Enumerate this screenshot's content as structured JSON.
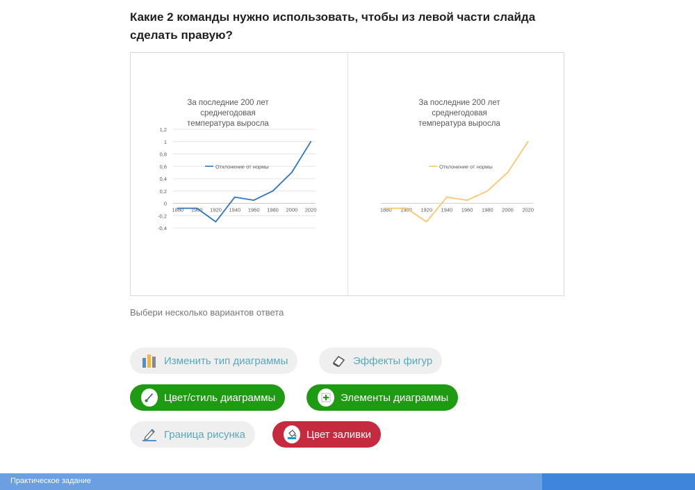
{
  "question": "Какие 2 команды нужно использовать, чтобы из левой части слайда сделать правую?",
  "hint": "Выбери несколько вариантов ответа",
  "options": [
    {
      "label": "Изменить тип диаграммы",
      "icon": "bar-chart-icon",
      "state": "unselected"
    },
    {
      "label": "Эффекты фигур",
      "icon": "eraser-icon",
      "state": "unselected"
    },
    {
      "label": "Цвет/стиль диаграммы",
      "icon": "brush-icon",
      "state": "correct"
    },
    {
      "label": "Элементы диаграммы",
      "icon": "plus-icon",
      "state": "correct"
    },
    {
      "label": "Граница рисунка",
      "icon": "pencil-icon",
      "state": "unselected"
    },
    {
      "label": "Цвет заливки",
      "icon": "paint-bucket-icon",
      "state": "wrong"
    }
  ],
  "footer": {
    "label": "Практическое задание",
    "progress": 0.78
  },
  "colors": {
    "left_line": "#2e75c0",
    "right_line": "#ffc56a",
    "correct": "#1e9b12",
    "wrong": "#c62a3f",
    "neutral_text": "#55aabb"
  },
  "chart_data": [
    {
      "type": "line",
      "title": "За последние 200 лет среднегодовая температура выросла",
      "x": [
        "1880",
        "1900",
        "1920",
        "1940",
        "1960",
        "1980",
        "2000",
        "2020"
      ],
      "series": [
        {
          "name": "Отклонение от нормы",
          "values": [
            -0.08,
            -0.08,
            -0.3,
            0.1,
            0.05,
            0.2,
            0.5,
            1.0
          ]
        }
      ],
      "yticks": [
        "1,2",
        "1",
        "0,8",
        "0,6",
        "0,4",
        "0,2",
        "0",
        "-0,2",
        "-0,4"
      ],
      "ylim": [
        -0.4,
        1.2
      ],
      "grid": true,
      "legend": "inside-left",
      "color": "#2e75c0"
    },
    {
      "type": "line",
      "title": "За последние 200 лет среднегодовая температура выросла",
      "x": [
        "1880",
        "1900",
        "1920",
        "1940",
        "1960",
        "1980",
        "2000",
        "2020"
      ],
      "series": [
        {
          "name": "Отклонение от нормы",
          "values": [
            -0.08,
            -0.08,
            -0.3,
            0.1,
            0.05,
            0.2,
            0.5,
            1.0
          ]
        }
      ],
      "ylim": [
        -0.4,
        1.2
      ],
      "grid": false,
      "y_axis_visible": false,
      "legend": "inside-left",
      "color": "#ffc56a"
    }
  ]
}
